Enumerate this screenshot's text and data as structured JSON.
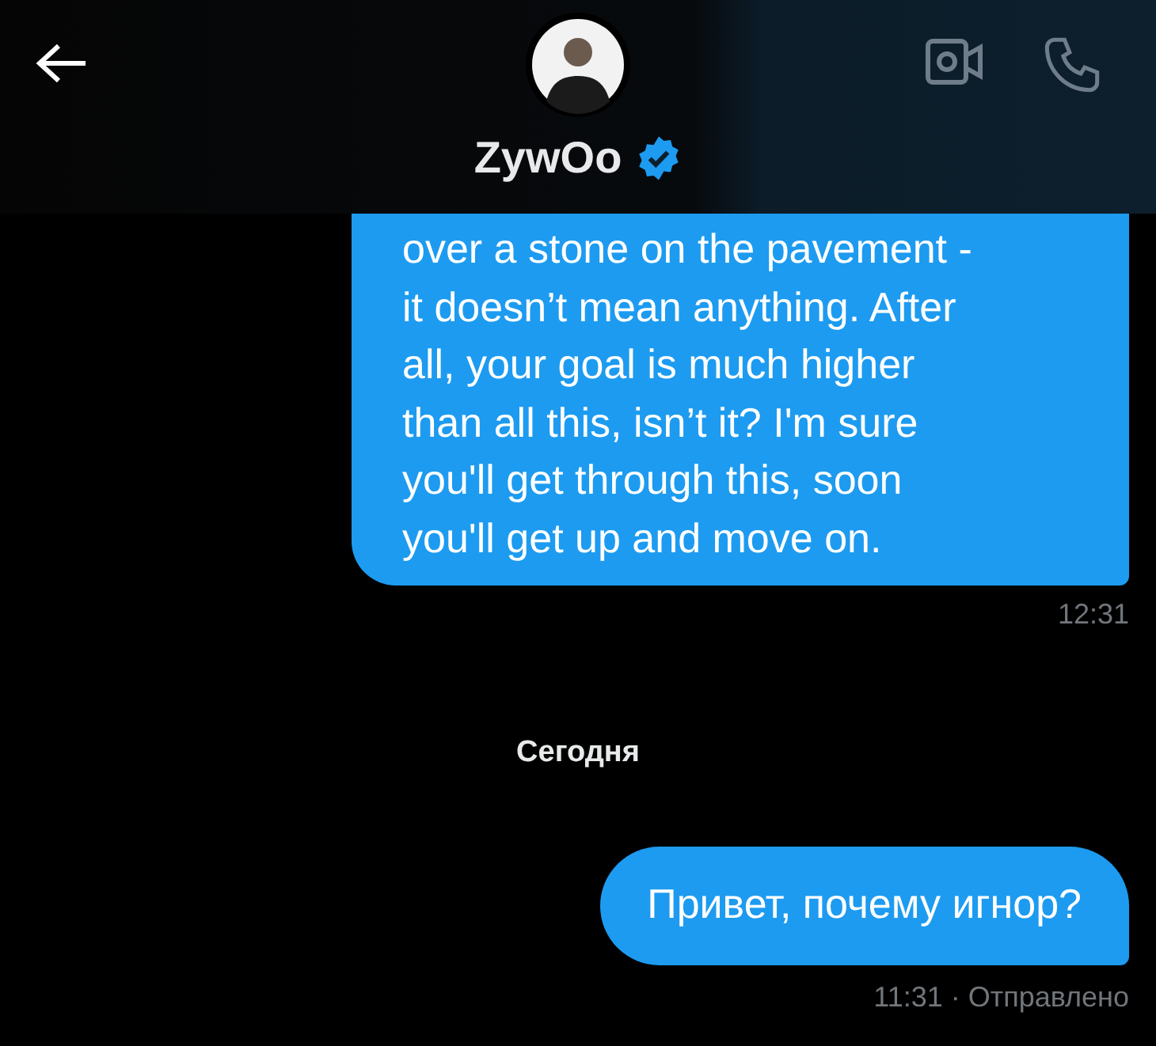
{
  "header": {
    "name": "ZywOo",
    "verified": true
  },
  "messages": [
    {
      "kind": "bubble",
      "lines": [
        "over a stone on the pavement -",
        "it doesn’t mean anything. After",
        "all, your goal is much higher",
        "than all this, isn’t it? I'm sure",
        "you'll get through this, soon",
        "you'll get up and move on."
      ],
      "meta": "12:31",
      "clipped": true
    },
    {
      "kind": "divider",
      "text": "Сегодня"
    },
    {
      "kind": "bubble",
      "lines": [
        "Привет, почему игнор?"
      ],
      "meta": "11:31 · Отправлено",
      "clipped": false
    }
  ]
}
